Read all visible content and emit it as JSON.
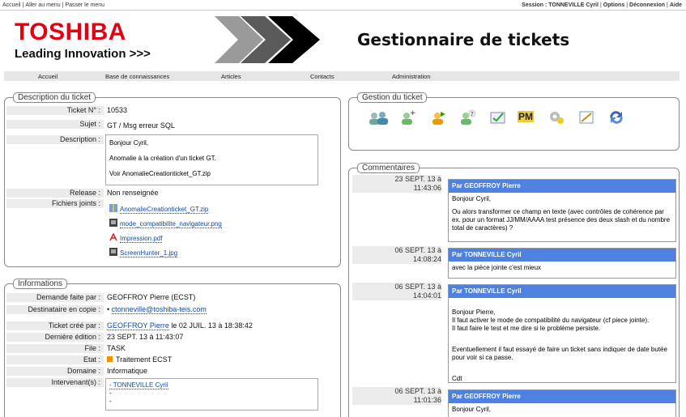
{
  "topbar": {
    "left_links": [
      "Accueil",
      "Aller au menu",
      "Passer le menu"
    ],
    "session": "Session : TONNEVILLE Cyril",
    "options": "Options",
    "disconnect": "Déconnexion",
    "help": "Aide"
  },
  "logo": {
    "brand": "TOSHIBA",
    "tagline": "Leading Innovation >>>"
  },
  "app_title": "Gestionnaire de tickets",
  "menu": [
    "Accueil",
    "Base de connaissances",
    "Articles",
    "Contacts",
    "Administration"
  ],
  "description": {
    "legend": "Description du ticket",
    "labels": {
      "ticket": "Ticket N° :",
      "subject": "Sujet :",
      "description": "Description :",
      "release": "Release :",
      "files": "Fichiers joints :"
    },
    "ticket_number": "10533",
    "subject": "GT / Msg erreur SQL",
    "description_lines": [
      "Bonjour Cyril,",
      "Anomalie à la création d'un ticket GT.",
      "Voir AnomalieCreationticket_GT.zip"
    ],
    "release": "Non renseignée",
    "files": [
      "AnomalieCreationticket_GT.zip",
      "mode_compatibilite_navigateur.png",
      "Impression.pdf",
      "ScreenHunter_1.jpg"
    ]
  },
  "informations": {
    "legend": "Informations",
    "labels": {
      "requested_by": "Demande faite par :",
      "cc": "Destinataire en copie :",
      "created_by": "Ticket créé par :",
      "last_edit": "Dernière édition :",
      "queue": "File :",
      "state": "Etat :",
      "domain": "Domaine :",
      "actors": "Intervenant(s) :"
    },
    "requested_by": "GEOFFROY Pierre (ECST)",
    "cc": "ctonneville@toshiba-teis.com",
    "created_by_name": "GEOFFROY Pierre",
    "created_by_rest": " le 02 JUIL. 13 à 18:38:42",
    "last_edit": "23 SEPT. 13 à 11:43:07",
    "queue": "TASK",
    "state": "Traitement ECST",
    "state_color": "#f39200",
    "domain": "Informatique",
    "actors": [
      "- TONNEVILLE Cyril",
      "-",
      "-"
    ]
  },
  "gestion": {
    "legend": "Gestion du ticket",
    "icons": [
      "add-users-icon",
      "add-user-icon",
      "transfer-user-icon",
      "question-user-icon",
      "check-mail-icon",
      "pm-icon",
      "settings-icon",
      "edit-icon",
      "refresh-icon"
    ],
    "pm_label": "PM"
  },
  "comments": {
    "legend": "Commentaires",
    "items": [
      {
        "date": "23 SEPT. 13 à",
        "time": "11:43:06",
        "author": "Par GEOFFROY Pierre",
        "paragraphs": [
          "Bonjour Cyril,",
          "Ou alors transformer ce champ en texte (avec contrôles de cohérence par ex. pour un format JJ/MM/AAAA test présence des deux slash et du nombre total de caractères) ?"
        ]
      },
      {
        "date": "06 SEPT. 13 à",
        "time": "14:08:24",
        "author": "Par TONNEVILLE Cyril",
        "paragraphs": [
          "avec la pièce jointe c'est mieux"
        ]
      },
      {
        "date": "06 SEPT. 13 à",
        "time": "14:04:01",
        "author": "Par TONNEVILLE Cyril",
        "paragraphs": [
          "Bonjour Pierre,\nIl faut activer le mode de compatibilité du navigateur (cf piece jointe).\nIl faut faire le test et me dire si le problème persiste.",
          "Eventuellement il faut essayé de faire un ticket sans indiquer de date butée pour voir si ca passe.",
          "Cdt"
        ]
      },
      {
        "date": "06 SEPT. 13 à",
        "time": "11:01:36",
        "author": "Par GEOFFROY Pierre",
        "paragraphs": [
          "Bonjour Cyril,"
        ]
      }
    ]
  },
  "colors": {
    "accent": "#4f82e0",
    "brand": "#e60012"
  }
}
